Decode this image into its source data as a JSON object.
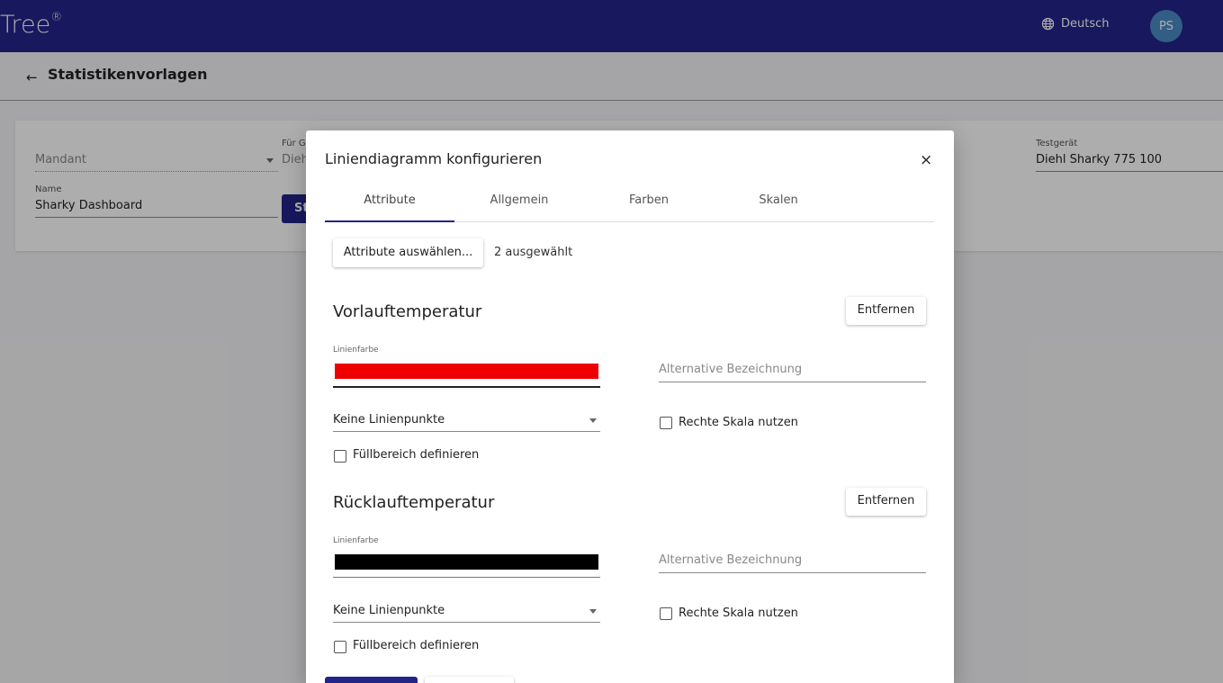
{
  "colors": {
    "brand": "#22248a",
    "avatar": "#4a89c4",
    "line_color_1": "#ee0000",
    "line_color_2": "#000000"
  },
  "topbar": {
    "logo_text": "Tree",
    "logo_mark": "®",
    "language_icon": "globe-icon",
    "language_label": "Deutsch",
    "avatar_initials": "PS"
  },
  "subheader": {
    "back_icon": "arrow-left-icon",
    "title": "Statistikenvorlagen"
  },
  "form": {
    "mandant_placeholder": "Mandant",
    "fuer_label": "Für Ge",
    "fuer_value": "Diehl",
    "name_label": "Name",
    "name_value": "Sharky Dashboard",
    "button_label": "St",
    "testgeraet_label": "Testgerät",
    "testgeraet_value": "Diehl Sharky 775 100"
  },
  "dialog": {
    "title": "Liniendiagramm konfigurieren",
    "close_icon": "close-icon",
    "close_glyph": "×",
    "tabs": [
      {
        "label": "Attribute"
      },
      {
        "label": "Allgemein"
      },
      {
        "label": "Farben"
      },
      {
        "label": "Skalen"
      }
    ],
    "select_attributes_label": "Attribute auswählen...",
    "selected_count": "2 ausgewählt",
    "attributes": [
      {
        "name": "Vorlauftemperatur",
        "remove_label": "Entfernen",
        "color_label": "Linienfarbe",
        "alt_name_placeholder": "Alternative Bezeichnung",
        "line_points": "Keine Linienpunkte",
        "right_scale_label": "Rechte Skala nutzen",
        "right_scale_checked": false,
        "fill_area_label": "Füllbereich definieren",
        "fill_area_checked": false
      },
      {
        "name": "Rücklauftemperatur",
        "remove_label": "Entfernen",
        "color_label": "Linienfarbe",
        "alt_name_placeholder": "Alternative Bezeichnung",
        "line_points": "Keine Linienpunkte",
        "right_scale_label": "Rechte Skala nutzen",
        "right_scale_checked": false,
        "fill_area_label": "Füllbereich definieren",
        "fill_area_checked": false
      }
    ]
  }
}
